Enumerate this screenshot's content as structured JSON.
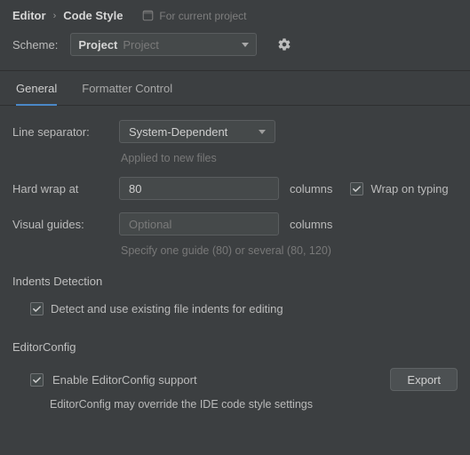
{
  "breadcrumb": {
    "a": "Editor",
    "b": "Code Style"
  },
  "project_badge": "For current project",
  "scheme": {
    "label": "Scheme:",
    "value_bold": "Project",
    "value_dim": "Project"
  },
  "tabs": {
    "general": "General",
    "formatter": "Formatter Control"
  },
  "line_sep": {
    "label": "Line separator:",
    "value": "System-Dependent",
    "hint": "Applied to new files"
  },
  "hard_wrap": {
    "label": "Hard wrap at",
    "value": "80",
    "unit": "columns",
    "wrap_on_typing": "Wrap on typing"
  },
  "visual_guides": {
    "label": "Visual guides:",
    "placeholder": "Optional",
    "unit": "columns",
    "hint": "Specify one guide (80) or several (80, 120)"
  },
  "indents": {
    "title": "Indents Detection",
    "check": "Detect and use existing file indents for editing"
  },
  "editorconfig": {
    "title": "EditorConfig",
    "enable": "Enable EditorConfig support",
    "export": "Export",
    "hint": "EditorConfig may override the IDE code style settings"
  }
}
